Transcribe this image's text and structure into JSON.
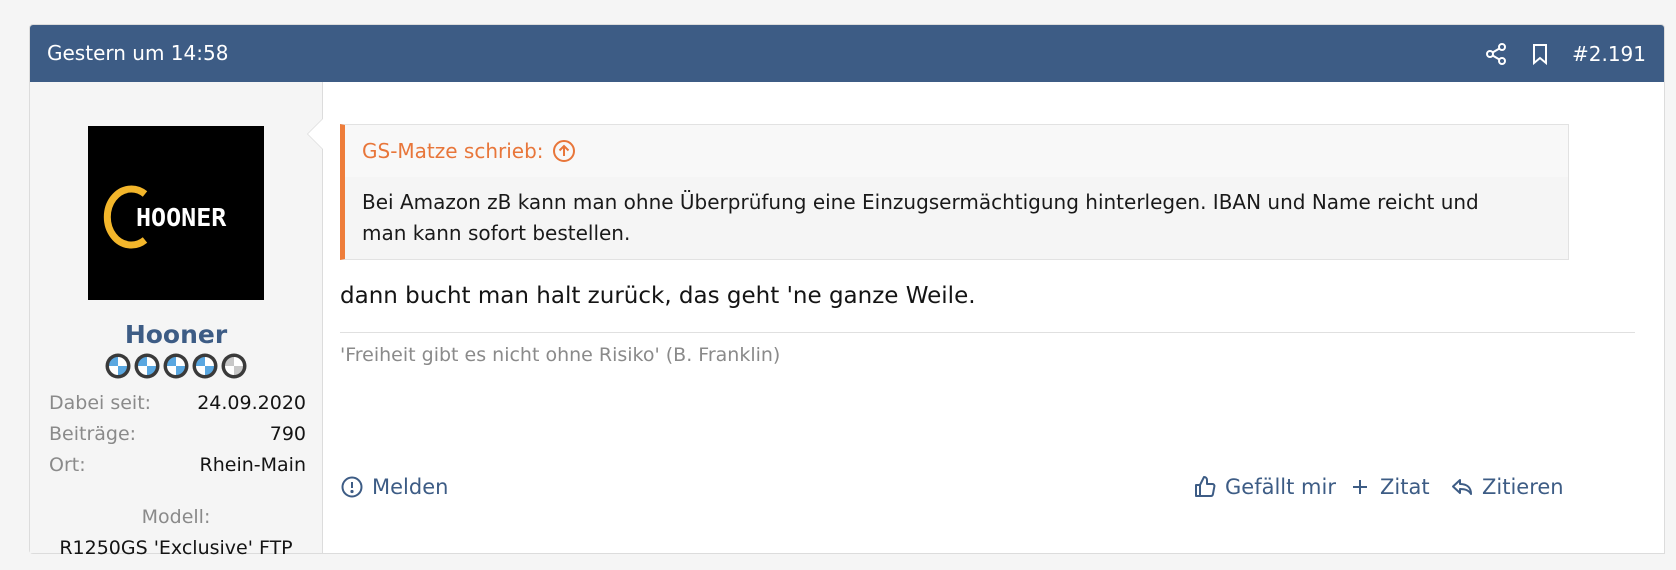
{
  "post": {
    "date": "Gestern um 14:58",
    "number": "#2.191",
    "share_icon": "share-icon",
    "bookmark_icon": "bookmark-icon"
  },
  "user": {
    "name": "Hooner",
    "avatar_text": "HOONER",
    "rank_icon": "bmw-roundel-rank-icon",
    "rank_level": {
      "filled": 4,
      "total": 5
    },
    "stats": [
      {
        "label": "Dabei seit:",
        "value": "24.09.2020"
      },
      {
        "label": "Beiträge:",
        "value": "790"
      },
      {
        "label": "Ort:",
        "value": "Rhein-Main"
      }
    ],
    "extra_label": "Modell:",
    "extra_value": "R1250GS 'Exclusive' FTP"
  },
  "quote": {
    "author": "GS-Matze schrieb:",
    "text": "Bei Amazon zB kann man ohne Überprüfung eine Einzugsermächtigung hinterlegen. IBAN und Name reicht und man kann sofort bestellen."
  },
  "message": "dann bucht man halt zurück, das geht 'ne ganze Weile.",
  "signature": "'Freiheit gibt es nicht ohne Risiko' (B. Franklin)",
  "actions": {
    "report": "Melden",
    "like": "Gefällt mir",
    "multiquote": "Zitat",
    "reply": "Zitieren"
  },
  "colors": {
    "header_bg": "#3d5c85",
    "accent_orange": "#ee7d3a",
    "link_blue": "#3d5c85",
    "avatar_ring": "#f3b62b"
  }
}
